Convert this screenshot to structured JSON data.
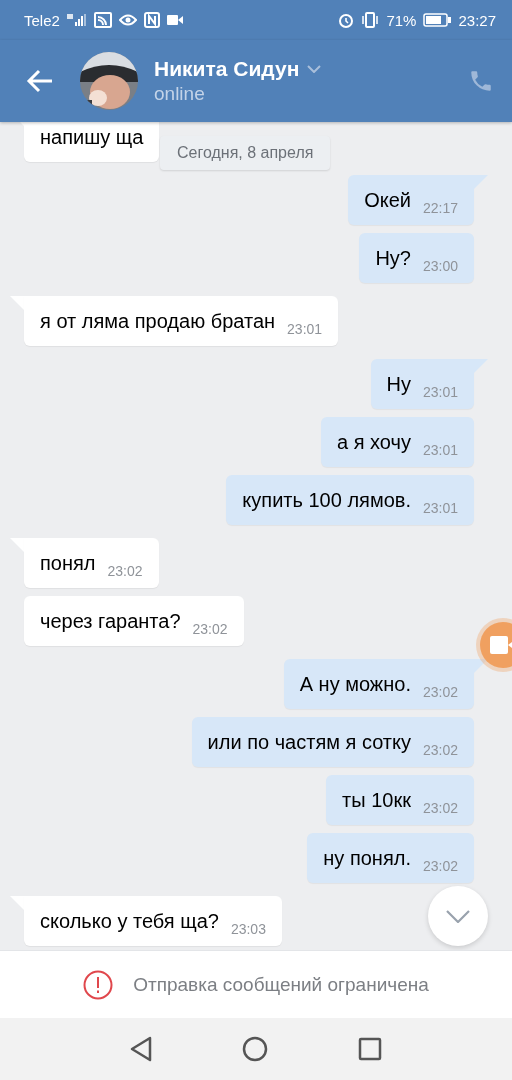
{
  "status_bar": {
    "carrier": "Tele2",
    "battery": "71%",
    "clock": "23:27"
  },
  "header": {
    "name": "Никита Сидун",
    "status": "online"
  },
  "date_divider": "Сегодня, 8 апреля",
  "messages": [
    {
      "kind": "incoming",
      "text": "напишу ща"
    },
    {
      "kind": "outgoing",
      "text": "Окей",
      "time": "22:17"
    },
    {
      "kind": "outgoing",
      "text": "Ну?",
      "time": "23:00"
    },
    {
      "kind": "incoming",
      "text": "я от ляма продаю братан",
      "time": "23:01"
    },
    {
      "kind": "outgoing",
      "text": "Ну",
      "time": "23:01"
    },
    {
      "kind": "outgoing",
      "text": "а я хочу",
      "time": "23:01"
    },
    {
      "kind": "outgoing",
      "text": "купить 100 лямов.",
      "time": "23:01"
    },
    {
      "kind": "incoming",
      "text": "понял",
      "time": "23:02"
    },
    {
      "kind": "incoming",
      "text": "через гаранта?",
      "time": "23:02"
    },
    {
      "kind": "outgoing",
      "text": "А ну можно.",
      "time": "23:02"
    },
    {
      "kind": "outgoing",
      "text": "или по частям я сотку",
      "time": "23:02"
    },
    {
      "kind": "outgoing",
      "text": "ты 10кк",
      "time": "23:02"
    },
    {
      "kind": "outgoing",
      "text": "ну понял.",
      "time": "23:02"
    },
    {
      "kind": "incoming",
      "text": "сколько у тебя ща?",
      "time": "23:03"
    }
  ],
  "notice": "Отправка сообщений ограничена"
}
